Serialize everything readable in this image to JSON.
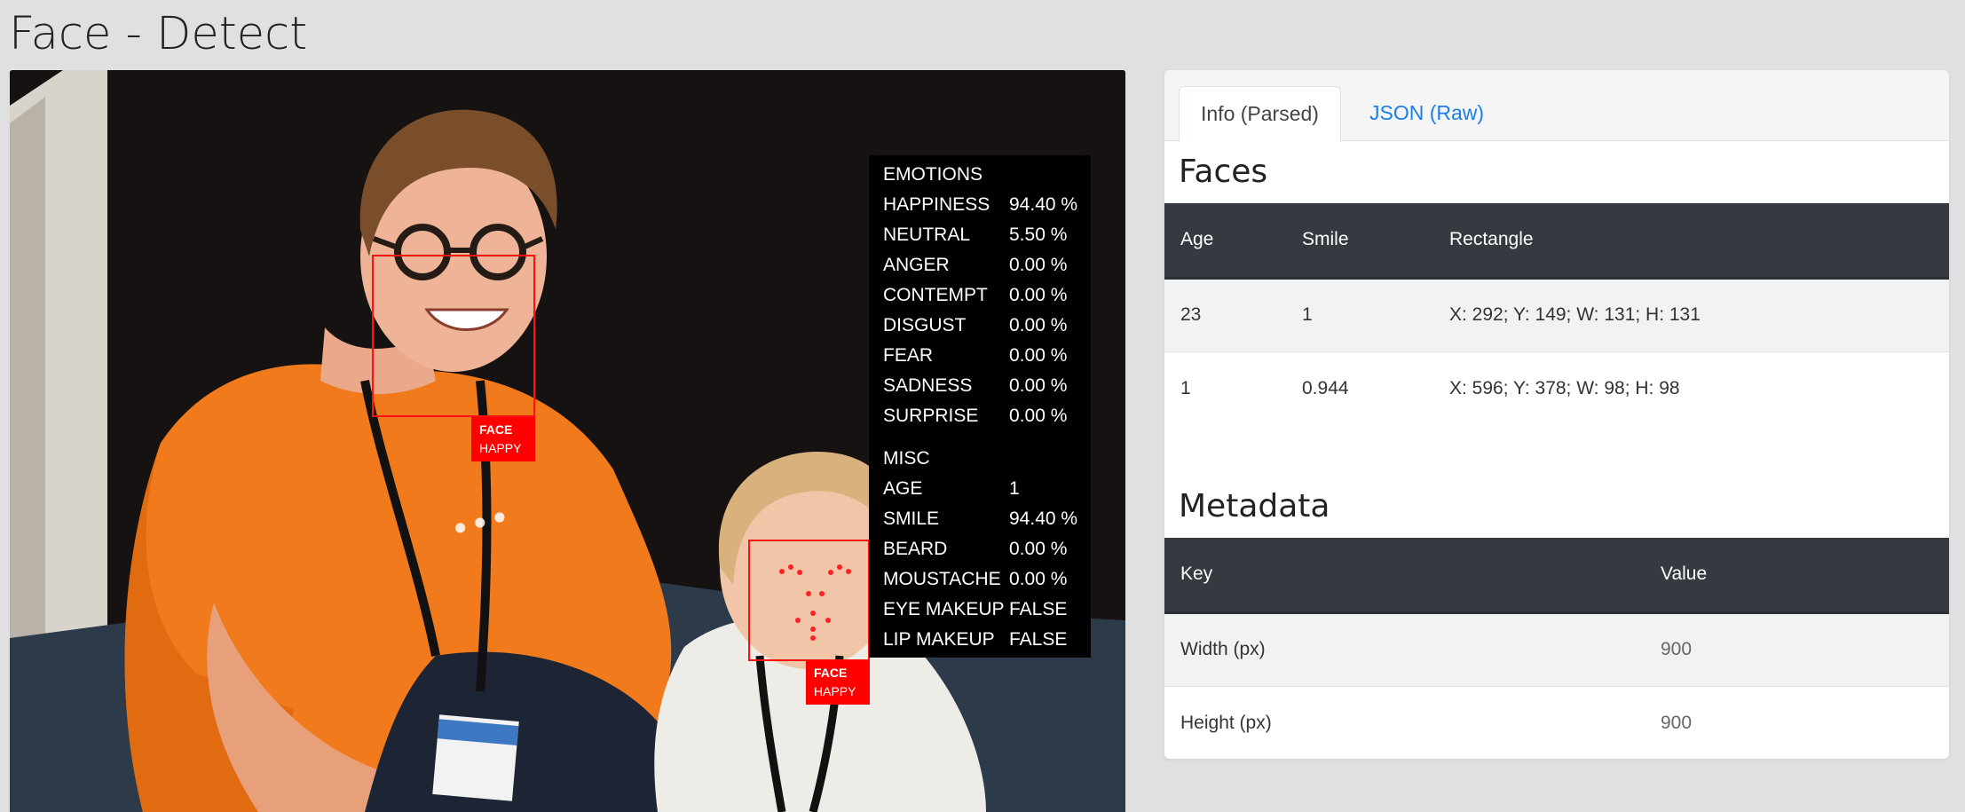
{
  "page": {
    "title": "Face - Detect"
  },
  "colors": {
    "face_box": "#ff0000",
    "tab_link": "#1a7fe8",
    "table_header": "#343a40"
  },
  "photo": {
    "faces": [
      {
        "tag_type": "FACE",
        "tag_emotion": "HAPPY"
      },
      {
        "tag_type": "FACE",
        "tag_emotion": "HAPPY"
      }
    ],
    "emotions_panel": {
      "emotions_heading": "EMOTIONS",
      "emotions": [
        {
          "key": "HAPPINESS",
          "value": "94.40 %"
        },
        {
          "key": "NEUTRAL",
          "value": "5.50 %"
        },
        {
          "key": "ANGER",
          "value": "0.00 %"
        },
        {
          "key": "CONTEMPT",
          "value": "0.00 %"
        },
        {
          "key": "DISGUST",
          "value": "0.00 %"
        },
        {
          "key": "FEAR",
          "value": "0.00 %"
        },
        {
          "key": "SADNESS",
          "value": "0.00 %"
        },
        {
          "key": "SURPRISE",
          "value": "0.00 %"
        }
      ],
      "misc_heading": "MISC",
      "misc": [
        {
          "key": "AGE",
          "value": "1"
        },
        {
          "key": "SMILE",
          "value": "94.40 %"
        },
        {
          "key": "BEARD",
          "value": "0.00 %"
        },
        {
          "key": "MOUSTACHE",
          "value": "0.00 %"
        },
        {
          "key": "EYE MAKEUP",
          "value": "FALSE"
        },
        {
          "key": "LIP MAKEUP",
          "value": "FALSE"
        }
      ]
    }
  },
  "tabs": [
    {
      "label": "Info (Parsed)",
      "active": true
    },
    {
      "label": "JSON (Raw)",
      "active": false
    }
  ],
  "faces_section": {
    "title": "Faces",
    "columns": [
      "Age",
      "Smile",
      "Rectangle"
    ],
    "rows": [
      [
        "23",
        "1",
        "X: 292; Y: 149; W: 131; H: 131"
      ],
      [
        "1",
        "0.944",
        "X: 596; Y: 378; W: 98; H: 98"
      ]
    ]
  },
  "metadata_section": {
    "title": "Metadata",
    "columns": [
      "Key",
      "Value"
    ],
    "rows": [
      [
        "Width (px)",
        "900"
      ],
      [
        "Height (px)",
        "900"
      ]
    ]
  }
}
